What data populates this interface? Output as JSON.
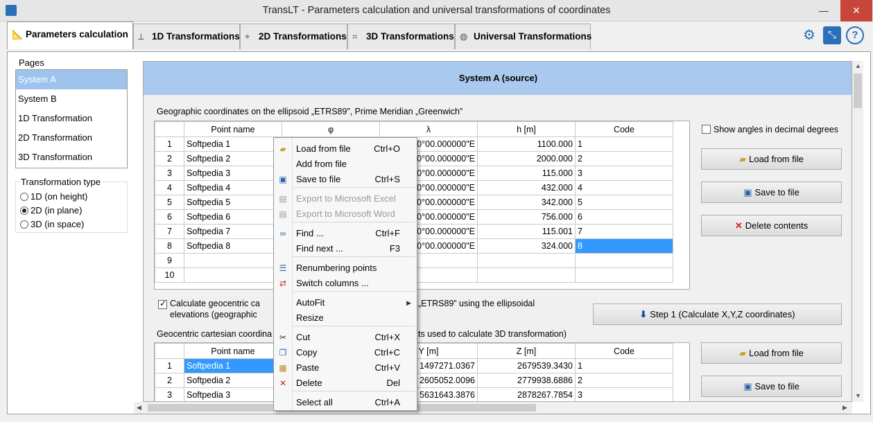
{
  "window": {
    "title": "TransLT - Parameters calculation and universal transformations of coordinates",
    "minimize": "—",
    "maximize": "☐",
    "close": "✕"
  },
  "tabs": [
    {
      "label": "Parameters calculation",
      "icon": "ruler-icon"
    },
    {
      "label": "1D Transformations",
      "icon": "height-icon"
    },
    {
      "label": "2D Transformations",
      "icon": "plane-icon"
    },
    {
      "label": "3D Transformations",
      "icon": "space-icon"
    },
    {
      "label": "Universal Transformations",
      "icon": "globe-icon"
    }
  ],
  "toolbar": {
    "settings_icon": "gear-icon",
    "export_icon": "pdf-icon",
    "help_icon": "help-icon"
  },
  "left": {
    "pages_label": "Pages",
    "pages": [
      "System A",
      "System B",
      "1D Transformation",
      "2D Transformation",
      "3D Transformation"
    ],
    "selected_page": "System A",
    "transformation_label": "Transformation type",
    "types": [
      "1D (on height)",
      "2D (in plane)",
      "3D (in space)"
    ],
    "selected_type": "2D (in plane)"
  },
  "main": {
    "header": "System A (source)",
    "geo_label": "Geographic coordinates on the ellipsoid „ETRS89”, Prime Meridian „Greenwich”",
    "geo_columns": [
      "",
      "Point name",
      "φ",
      "λ",
      "h [m]",
      "Code"
    ],
    "geo_rows": [
      [
        "1",
        "Softpedia 1",
        "",
        "00°00.000000\"E",
        "1100.000",
        "1"
      ],
      [
        "2",
        "Softpedia 2",
        "",
        "00°00.000000\"E",
        "2000.000",
        "2"
      ],
      [
        "3",
        "Softpedia 3",
        "",
        "00°00.000000\"E",
        "115.000",
        "3"
      ],
      [
        "4",
        "Softpedia 4",
        "",
        "00°00.000000\"E",
        "432.000",
        "4"
      ],
      [
        "5",
        "Softpedia 5",
        "",
        "00°00.000000\"E",
        "342.000",
        "5"
      ],
      [
        "6",
        "Softpedia 6",
        "",
        "00°00.000000\"E",
        "756.000",
        "6"
      ],
      [
        "7",
        "Softpedia 7",
        "",
        "00°00.000000\"E",
        "115.001",
        "7"
      ],
      [
        "8",
        "Softpedia 8",
        "",
        "00°00.000000\"E",
        "324.000",
        "8"
      ],
      [
        "9",
        "",
        "",
        "",
        "",
        ""
      ],
      [
        "10",
        "",
        "",
        "",
        "",
        ""
      ]
    ],
    "show_decimal_label": "Show angles in decimal degrees",
    "load_label": "Load from file",
    "save_label": "Save to file",
    "delete_label": "Delete contents",
    "calc_label_1": "Calculate geocentric ca",
    "calc_label_1b": "„ETRS89” using the ellipsoidal",
    "calc_label_2": "elevations (geographic",
    "step_label": "Step 1 (Calculate X,Y,Z coordinates)",
    "cart_label_a": "Geocentric cartesian coordina",
    "cart_label_b": "ts used to calculate 3D transformation)",
    "cart_columns": [
      "",
      "Point name",
      "",
      "Y [m]",
      "Z [m]",
      "Code"
    ],
    "cart_rows": [
      [
        "1",
        "Softpedia 1",
        "",
        "1497271.0367",
        "2679539.3430",
        "1"
      ],
      [
        "2",
        "Softpedia 2",
        "",
        "2605052.0096",
        "2779938.6886",
        "2"
      ],
      [
        "3",
        "Softpedia 3",
        "",
        "5631643.3876",
        "2878267.7854",
        "3"
      ]
    ],
    "load_label2": "Load from file",
    "save_label2": "Save to file"
  },
  "context_menu": [
    {
      "label": "Load from file",
      "shortcut": "Ctrl+O",
      "icon": "folder-open-icon",
      "disabled": false
    },
    {
      "label": "Add from file",
      "shortcut": "",
      "icon": "",
      "disabled": false
    },
    {
      "label": "Save to file",
      "shortcut": "Ctrl+S",
      "icon": "floppy-icon",
      "disabled": false
    },
    {
      "label": "Export to Microsoft Excel",
      "shortcut": "",
      "icon": "excel-icon",
      "disabled": true
    },
    {
      "label": "Export to Microsoft Word",
      "shortcut": "",
      "icon": "word-icon",
      "disabled": true
    },
    {
      "label": "Find ...",
      "shortcut": "Ctrl+F",
      "icon": "binoculars-icon",
      "disabled": false
    },
    {
      "label": "Find next ...",
      "shortcut": "F3",
      "icon": "",
      "disabled": false
    },
    {
      "label": "Renumbering points",
      "shortcut": "",
      "icon": "renumber-icon",
      "disabled": false
    },
    {
      "label": "Switch columns ...",
      "shortcut": "",
      "icon": "switch-columns-icon",
      "disabled": false
    },
    {
      "label": "AutoFit",
      "shortcut": "",
      "icon": "",
      "disabled": false
    },
    {
      "label": "Resize",
      "shortcut": "",
      "icon": "",
      "disabled": false
    },
    {
      "label": "Cut",
      "shortcut": "Ctrl+X",
      "icon": "scissors-icon",
      "disabled": false
    },
    {
      "label": "Copy",
      "shortcut": "Ctrl+C",
      "icon": "copy-icon",
      "disabled": false
    },
    {
      "label": "Paste",
      "shortcut": "Ctrl+V",
      "icon": "paste-icon",
      "disabled": false
    },
    {
      "label": "Delete",
      "shortcut": "Del",
      "icon": "delete-icon",
      "disabled": false
    },
    {
      "label": "Select all",
      "shortcut": "Ctrl+A",
      "icon": "",
      "disabled": false
    }
  ],
  "colors": {
    "selection": "#3399ff",
    "header_band": "#a9c9ee",
    "delete_red": "#d32020"
  }
}
